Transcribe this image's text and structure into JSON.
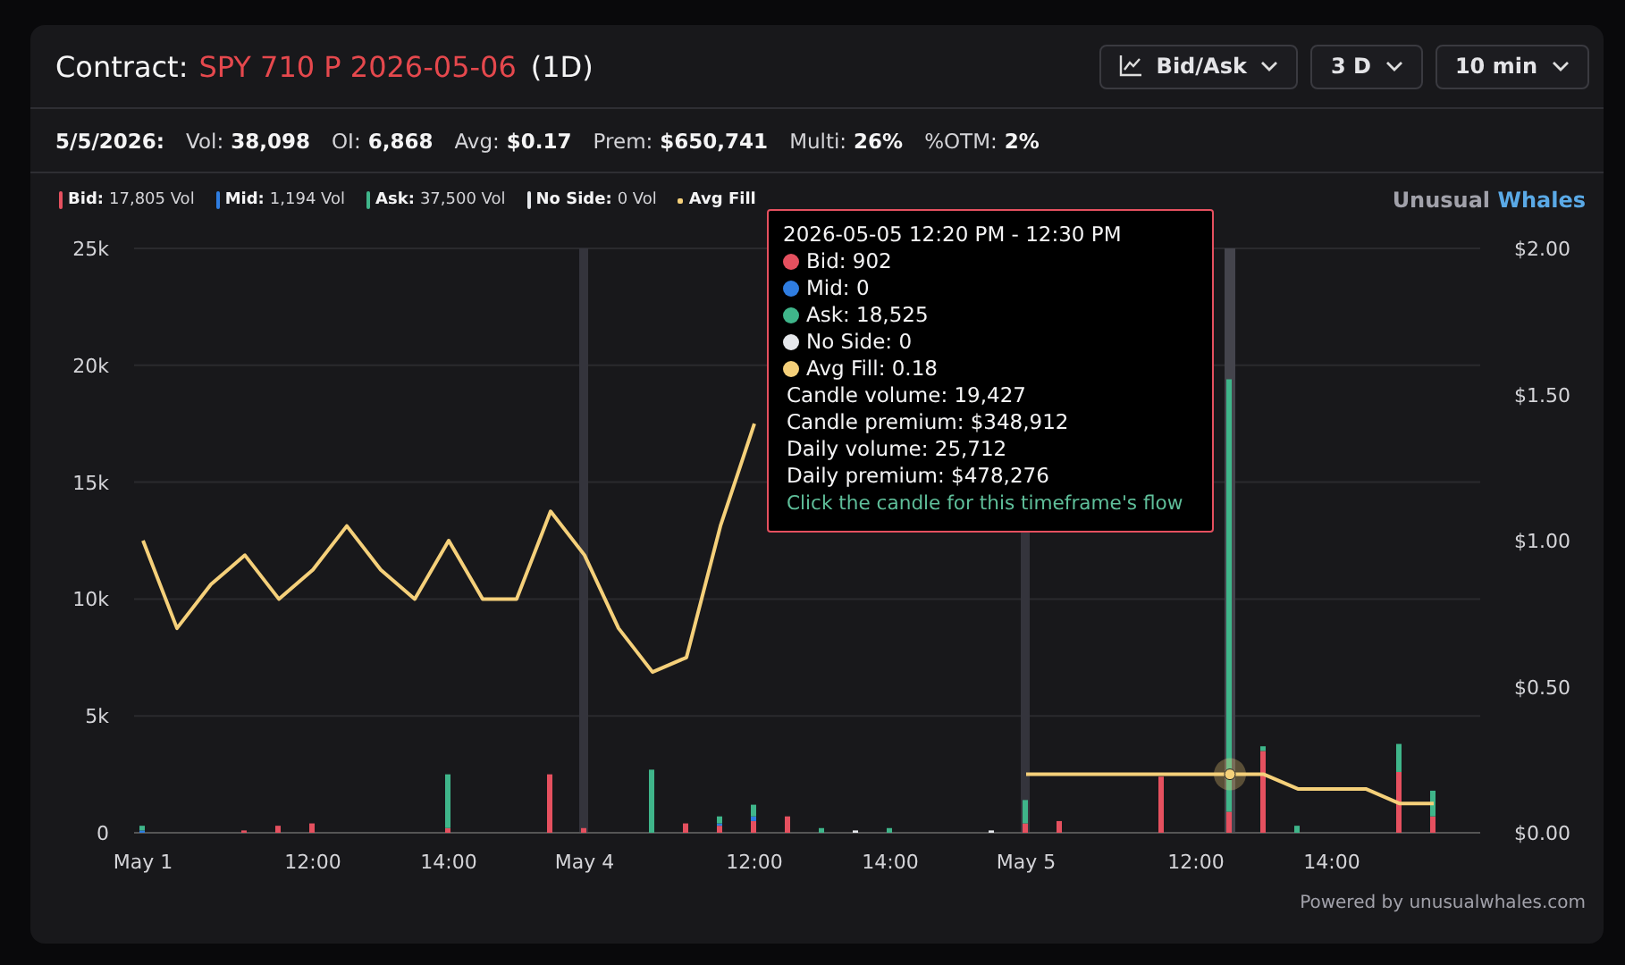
{
  "header": {
    "label": "Contract:",
    "contract": "SPY 710 P 2026-05-06",
    "expiry_note": "(1D)",
    "controls": [
      {
        "kind": "chart",
        "label": "Bid/Ask"
      },
      {
        "kind": "plain",
        "label": "3 D"
      },
      {
        "kind": "plain",
        "label": "10 min"
      }
    ]
  },
  "stats": {
    "date": "5/5/2026:",
    "items": [
      {
        "label": "Vol:",
        "value": "38,098"
      },
      {
        "label": "OI:",
        "value": "6,868"
      },
      {
        "label": "Avg:",
        "value": "$0.17"
      },
      {
        "label": "Prem:",
        "value": "$650,741"
      },
      {
        "label": "Multi:",
        "value": "26%"
      },
      {
        "label": "%OTM:",
        "value": "2%"
      }
    ]
  },
  "legend": [
    {
      "value": "17,805 Vol"
    },
    {
      "value": "1,194 Vol"
    },
    {
      "value": "37,500 Vol"
    },
    {
      "value": "0 Vol"
    }
  ],
  "brand": {
    "first": "Unusual",
    "second": "Whales"
  },
  "chart_data": {
    "type": "bar",
    "stacked": true,
    "grid": true,
    "categories": [
      "May 1",
      null,
      null,
      null,
      null,
      "12:00",
      null,
      null,
      null,
      "14:00",
      null,
      null,
      null,
      "May 4",
      null,
      null,
      null,
      null,
      "12:00",
      null,
      null,
      null,
      "14:00",
      null,
      null,
      null,
      "May 5",
      null,
      null,
      null,
      null,
      "12:00",
      null,
      null,
      null,
      "14:00",
      null,
      null,
      null
    ],
    "yticks": [
      {
        "value": 0,
        "label": "0"
      },
      {
        "value": 5000,
        "label": "5k"
      },
      {
        "value": 10000,
        "label": "10k"
      },
      {
        "value": 15000,
        "label": "15k"
      },
      {
        "value": 20000,
        "label": "20k"
      },
      {
        "value": 25000,
        "label": "25k"
      }
    ],
    "ylim": [
      0,
      25000
    ],
    "y2ticks": [
      {
        "value": 0,
        "label": "$0.00"
      },
      {
        "value": 0.5,
        "label": "$0.50"
      },
      {
        "value": 1,
        "label": "$1.00"
      },
      {
        "value": 1.5,
        "label": "$1.50"
      },
      {
        "value": 2,
        "label": "$2.00"
      }
    ],
    "y2lim": [
      0,
      2
    ],
    "series": [
      {
        "name": "Bid:",
        "color": "#e5505f",
        "values": [
          0,
          0,
          0,
          100,
          300,
          400,
          0,
          0,
          0,
          200,
          0,
          0,
          2500,
          200,
          0,
          0,
          400,
          300,
          500,
          700,
          0,
          0,
          0,
          0,
          0,
          0,
          400,
          500,
          0,
          0,
          2400,
          0,
          900,
          3500,
          0,
          0,
          0,
          2600,
          700
        ]
      },
      {
        "name": "Mid:",
        "color": "#2f7de1",
        "values": [
          100,
          0,
          0,
          0,
          0,
          0,
          0,
          0,
          0,
          0,
          0,
          0,
          0,
          0,
          0,
          0,
          0,
          100,
          200,
          0,
          0,
          0,
          0,
          0,
          0,
          0,
          0,
          0,
          0,
          0,
          0,
          0,
          0,
          0,
          0,
          0,
          0,
          0,
          0
        ]
      },
      {
        "name": "Ask:",
        "color": "#3fb58a",
        "values": [
          200,
          0,
          0,
          0,
          0,
          0,
          0,
          0,
          0,
          2300,
          0,
          0,
          0,
          0,
          0,
          2700,
          0,
          300,
          500,
          0,
          200,
          0,
          200,
          0,
          0,
          0,
          1000,
          0,
          0,
          0,
          0,
          0,
          18500,
          200,
          300,
          0,
          0,
          1200,
          1100
        ]
      },
      {
        "name": "No Side:",
        "color": "#e5e7eb",
        "values": [
          0,
          0,
          0,
          0,
          0,
          0,
          0,
          0,
          0,
          0,
          0,
          0,
          0,
          0,
          0,
          0,
          0,
          0,
          0,
          0,
          0,
          100,
          0,
          0,
          0,
          100,
          0,
          0,
          0,
          0,
          0,
          0,
          0,
          0,
          0,
          0,
          0,
          0,
          0
        ]
      },
      {
        "name": "Avg Fill",
        "color": "#f5d07a",
        "type": "line",
        "axis": "y2",
        "values": [
          1,
          0.7,
          0.85,
          0.95,
          0.8,
          0.9,
          1.05,
          0.9,
          0.8,
          1,
          0.8,
          0.8,
          1.1,
          0.95,
          0.7,
          0.55,
          0.6,
          1.05,
          1.4,
          null,
          null,
          null,
          null,
          null,
          null,
          null,
          0.2,
          0.2,
          0.2,
          0.2,
          0.2,
          0.2,
          0.2,
          0.2,
          0.15,
          0.15,
          0.15,
          0.1,
          0.1
        ]
      }
    ]
  },
  "tooltip": {
    "title": "2026-05-05 12:20 PM - 12:30 PM",
    "series": [
      {
        "label": "Bid: 902",
        "color": "#e5505f"
      },
      {
        "label": "Mid: 0",
        "color": "#2f7de1"
      },
      {
        "label": "Ask: 18,525",
        "color": "#3fb58a"
      },
      {
        "label": "No Side: 0",
        "color": "#e5e7eb"
      },
      {
        "label": "Avg Fill: 0.18",
        "color": "#f5d07a"
      }
    ],
    "lines": [
      "Candle volume: 19,427",
      "Candle premium: $348,912",
      "Daily volume: 25,712",
      "Daily premium: $478,276"
    ],
    "link": "Click the candle for this timeframe's flow"
  },
  "footer": "Powered by unusualwhales.com"
}
